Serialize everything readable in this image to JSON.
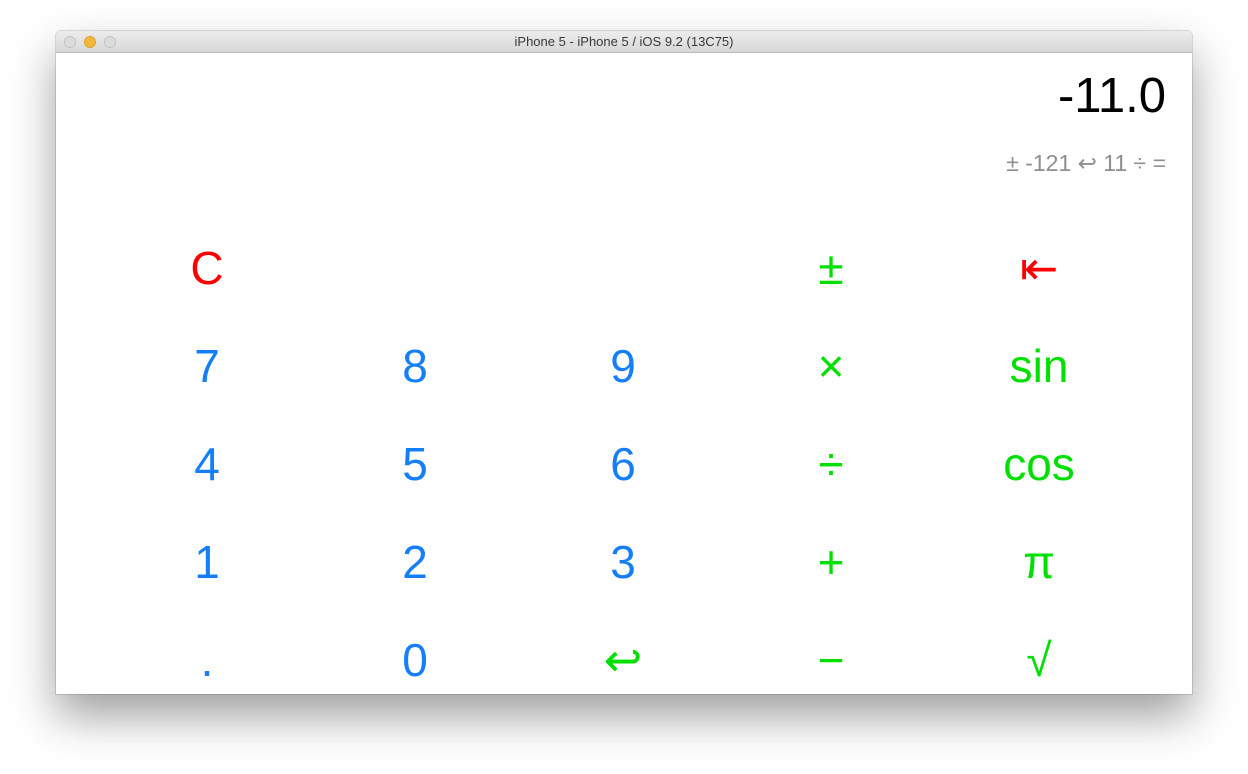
{
  "window": {
    "title": "iPhone 5 - iPhone 5 / iOS 9.2 (13C75)"
  },
  "display": {
    "value": "-11.0",
    "history": "± -121 ↩ 11 ÷ ="
  },
  "keys": {
    "clear": "C",
    "plus_minus": "±",
    "backspace": "⇤",
    "seven": "7",
    "eight": "8",
    "nine": "9",
    "multiply": "×",
    "sin": "sin",
    "four": "4",
    "five": "5",
    "six": "6",
    "divide": "÷",
    "cos": "cos",
    "one": "1",
    "two": "2",
    "three": "3",
    "plus": "+",
    "pi": "π",
    "decimal": ".",
    "zero": "0",
    "enter": "↩",
    "minus": "−",
    "sqrt": "√"
  },
  "colors": {
    "digit": "#147efb",
    "operation": "#00e000",
    "destructive": "#ff0000",
    "display_text": "#000000",
    "history_text": "#8e8e93"
  }
}
